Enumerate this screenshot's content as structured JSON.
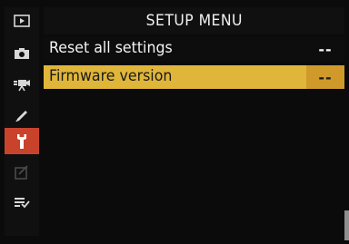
{
  "header": {
    "title": "SETUP MENU"
  },
  "sidebar": {
    "items": [
      {
        "icon": "playback-icon",
        "active": false
      },
      {
        "icon": "camera-icon",
        "active": false
      },
      {
        "icon": "movie-camera-icon",
        "active": false
      },
      {
        "icon": "pencil-icon",
        "active": false
      },
      {
        "icon": "wrench-icon",
        "active": true
      },
      {
        "icon": "retouch-icon",
        "active": false
      },
      {
        "icon": "my-menu-icon",
        "active": false
      }
    ]
  },
  "menu": {
    "items": [
      {
        "label": "Reset all settings",
        "value": "--",
        "selected": false
      },
      {
        "label": "Firmware version",
        "value": "--",
        "selected": true
      }
    ]
  },
  "colors": {
    "highlight": "#e0b63a",
    "highlight_value": "#cf9a2a",
    "active_tab": "#c9432c",
    "background": "#0b0b0b"
  }
}
